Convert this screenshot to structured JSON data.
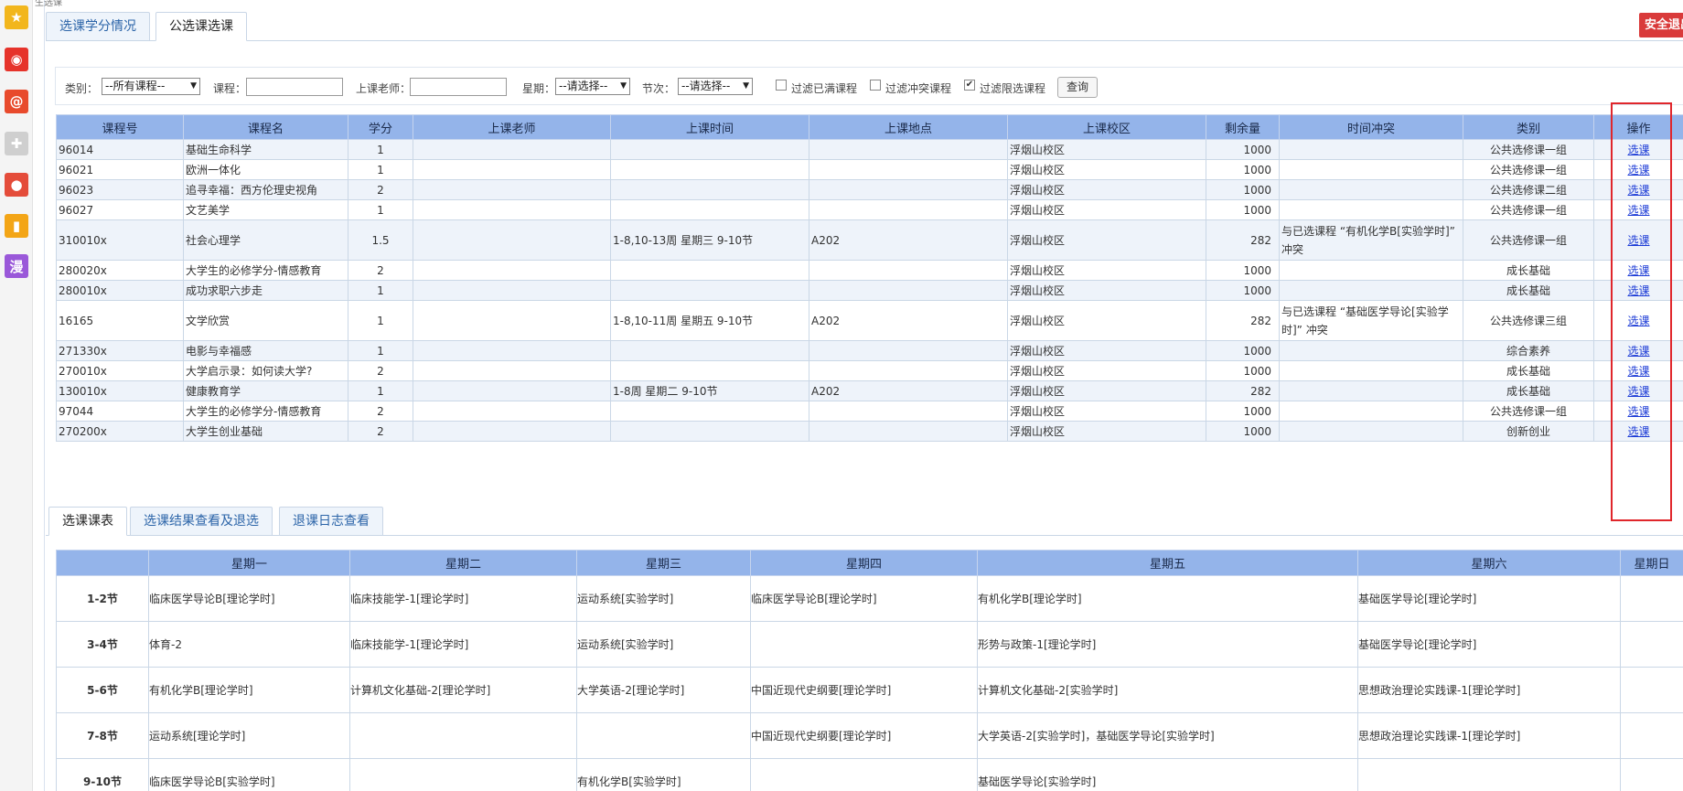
{
  "top_text": "生选课",
  "tabs": [
    "选课学分情况",
    "公选课选课"
  ],
  "exit_label": "安全退出",
  "filter": {
    "category_label": "类别：",
    "category_value": "--所有课程--",
    "course_label": "课程：",
    "teacher_label": "上课老师：",
    "weekday_label": "星期：",
    "weekday_value": "--请选择--",
    "period_label": "节次：",
    "period_value": "--请选择--",
    "filter_full_label": "过滤已满课程",
    "filter_conflict_label": "过滤冲突课程",
    "filter_limit_label": "过滤限选课程",
    "query_label": "查询"
  },
  "course_table": {
    "headers": [
      "课程号",
      "课程名",
      "学分",
      "上课老师",
      "上课时间",
      "上课地点",
      "上课校区",
      "剩余量",
      "时间冲突",
      "类别",
      "操作"
    ],
    "rows": [
      {
        "id": "96014",
        "name": "基础生命科学",
        "credit": "1",
        "teacher": "",
        "time": "",
        "place": "",
        "campus": "浮烟山校区",
        "remain": "1000",
        "conflict": "",
        "category": "公共选修课一组",
        "action": "选课"
      },
      {
        "id": "96021",
        "name": "欧洲一体化",
        "credit": "1",
        "teacher": "",
        "time": "",
        "place": "",
        "campus": "浮烟山校区",
        "remain": "1000",
        "conflict": "",
        "category": "公共选修课一组",
        "action": "选课"
      },
      {
        "id": "96023",
        "name": "追寻幸福：西方伦理史视角",
        "credit": "2",
        "teacher": "",
        "time": "",
        "place": "",
        "campus": "浮烟山校区",
        "remain": "1000",
        "conflict": "",
        "category": "公共选修课二组",
        "action": "选课"
      },
      {
        "id": "96027",
        "name": "文艺美学",
        "credit": "1",
        "teacher": "",
        "time": "",
        "place": "",
        "campus": "浮烟山校区",
        "remain": "1000",
        "conflict": "",
        "category": "公共选修课一组",
        "action": "选课"
      },
      {
        "id": "310010x",
        "name": "社会心理学",
        "credit": "1.5",
        "teacher": "",
        "time": "1-8,10-13周 星期三 9-10节",
        "place": "A202",
        "campus": "浮烟山校区",
        "remain": "282",
        "conflict": "与已选课程 “有机化学B[实验学时]” 冲突",
        "category": "公共选修课一组",
        "action": "选课"
      },
      {
        "id": "280020x",
        "name": "大学生的必修学分-情感教育",
        "credit": "2",
        "teacher": "",
        "time": "",
        "place": "",
        "campus": "浮烟山校区",
        "remain": "1000",
        "conflict": "",
        "category": "成长基础",
        "action": "选课"
      },
      {
        "id": "280010x",
        "name": "成功求职六步走",
        "credit": "1",
        "teacher": "",
        "time": "",
        "place": "",
        "campus": "浮烟山校区",
        "remain": "1000",
        "conflict": "",
        "category": "成长基础",
        "action": "选课"
      },
      {
        "id": "16165",
        "name": "文学欣赏",
        "credit": "1",
        "teacher": "",
        "time": "1-8,10-11周 星期五 9-10节",
        "place": "A202",
        "campus": "浮烟山校区",
        "remain": "282",
        "conflict": "与已选课程 “基础医学导论[实验学时]” 冲突",
        "category": "公共选修课三组",
        "action": "选课"
      },
      {
        "id": "271330x",
        "name": "电影与幸福感",
        "credit": "1",
        "teacher": "",
        "time": "",
        "place": "",
        "campus": "浮烟山校区",
        "remain": "1000",
        "conflict": "",
        "category": "综合素养",
        "action": "选课"
      },
      {
        "id": "270010x",
        "name": "大学启示录：如何读大学?",
        "credit": "2",
        "teacher": "",
        "time": "",
        "place": "",
        "campus": "浮烟山校区",
        "remain": "1000",
        "conflict": "",
        "category": "成长基础",
        "action": "选课"
      },
      {
        "id": "130010x",
        "name": "健康教育学",
        "credit": "1",
        "teacher": "",
        "time": "1-8周 星期二 9-10节",
        "place": "A202",
        "campus": "浮烟山校区",
        "remain": "282",
        "conflict": "",
        "category": "成长基础",
        "action": "选课"
      },
      {
        "id": "97044",
        "name": "大学生的必修学分-情感教育",
        "credit": "2",
        "teacher": "",
        "time": "",
        "place": "",
        "campus": "浮烟山校区",
        "remain": "1000",
        "conflict": "",
        "category": "公共选修课一组",
        "action": "选课"
      },
      {
        "id": "270200x",
        "name": "大学生创业基础",
        "credit": "2",
        "teacher": "",
        "time": "",
        "place": "",
        "campus": "浮烟山校区",
        "remain": "1000",
        "conflict": "",
        "category": "创新创业",
        "action": "选课"
      }
    ]
  },
  "bottom_tabs": [
    "选课课表",
    "选课结果查看及退选",
    "退课日志查看"
  ],
  "schedule": {
    "headers": [
      "",
      "星期一",
      "星期二",
      "星期三",
      "星期四",
      "星期五",
      "星期六",
      "星期日"
    ],
    "rows": [
      {
        "period": "1-2节",
        "cells": [
          "临床医学导论B[理论学时]",
          "临床技能学-1[理论学时]",
          "运动系统[实验学时]",
          "临床医学导论B[理论学时]",
          "有机化学B[理论学时]",
          "基础医学导论[理论学时]",
          ""
        ]
      },
      {
        "period": "3-4节",
        "cells": [
          "体育-2",
          "临床技能学-1[理论学时]",
          "运动系统[实验学时]",
          "",
          "形势与政策-1[理论学时]",
          "基础医学导论[理论学时]",
          ""
        ]
      },
      {
        "period": "5-6节",
        "cells": [
          "有机化学B[理论学时]",
          "计算机文化基础-2[理论学时]",
          "大学英语-2[理论学时]",
          "中国近现代史纲要[理论学时]",
          "计算机文化基础-2[实验学时]",
          "思想政治理论实践课-1[理论学时]",
          ""
        ]
      },
      {
        "period": "7-8节",
        "cells": [
          "运动系统[理论学时]",
          "",
          "",
          "中国近现代史纲要[理论学时]",
          "大学英语-2[实验学时]，基础医学导论[实验学时]",
          "思想政治理论实践课-1[理论学时]",
          ""
        ]
      },
      {
        "period": "9-10节",
        "cells": [
          "临床医学导论B[实验学时]",
          "",
          "有机化学B[实验学时]",
          "",
          "基础医学导论[实验学时]",
          "",
          ""
        ]
      }
    ]
  },
  "rail_icons": [
    {
      "name": "star-icon",
      "glyph": "★",
      "color": "#f2b61c"
    },
    {
      "name": "weibo-icon",
      "glyph": "◉",
      "color": "#e6332a"
    },
    {
      "name": "at-mail-icon",
      "glyph": "@",
      "color": "#e84a2c"
    },
    {
      "name": "puzzle-icon",
      "glyph": "✚",
      "color": "#cfcfcf"
    },
    {
      "name": "game-icon",
      "glyph": "●",
      "color": "#e44c3a"
    },
    {
      "name": "book-icon",
      "glyph": "▮",
      "color": "#f3a516"
    },
    {
      "name": "manga-icon",
      "glyph": "漫",
      "color": "#9a58d9"
    }
  ]
}
